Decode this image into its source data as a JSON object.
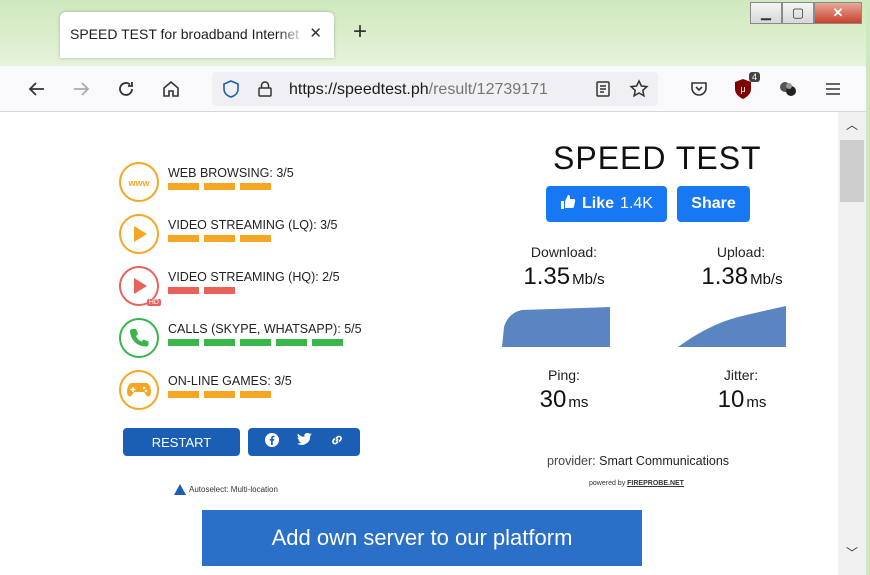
{
  "window": {
    "min": "▁",
    "max": "▢",
    "close": "✕"
  },
  "tab": {
    "title": "SPEED TEST for broadband Internet",
    "close": "✕",
    "new_tab": "+"
  },
  "toolbar": {
    "url_host": "https://speedtest.ph",
    "url_path": "/result/12739171",
    "extension_badge": "4"
  },
  "categories": [
    {
      "label": "WEB BROWSING: 3/5",
      "score": 3,
      "color": "#f5a623",
      "icon": "www-icon"
    },
    {
      "label": "VIDEO STREAMING (LQ): 3/5",
      "score": 3,
      "color": "#f5a623",
      "icon": "play-icon"
    },
    {
      "label": "VIDEO STREAMING (HQ): 2/5",
      "score": 2,
      "color": "#e8625b",
      "icon": "play-hd-icon"
    },
    {
      "label": "CALLS (SKYPE, WHATSAPP): 5/5",
      "score": 5,
      "color": "#39b54a",
      "icon": "phone-icon"
    },
    {
      "label": "ON-LINE GAMES: 3/5",
      "score": 3,
      "color": "#f5a623",
      "icon": "gamepad-icon"
    }
  ],
  "icon_text": {
    "www": "www",
    "hd": "HD"
  },
  "restart_label": "RESTART",
  "autoselect": "Autoselect: Multi-location",
  "title": "SPEED TEST",
  "facebook": {
    "like_label": "Like",
    "like_count": "1.4K",
    "share_label": "Share"
  },
  "metrics": {
    "download": {
      "label": "Download:",
      "value": "1.35",
      "unit": "Mb/s"
    },
    "upload": {
      "label": "Upload:",
      "value": "1.38",
      "unit": "Mb/s"
    },
    "ping": {
      "label": "Ping:",
      "value": "30",
      "unit": "ms"
    },
    "jitter": {
      "label": "Jitter:",
      "value": "10",
      "unit": "ms"
    }
  },
  "provider": {
    "prefix": "provider:",
    "name": "Smart Communications"
  },
  "powered": {
    "prefix": "powered by",
    "name": "FIREPROBE.NET"
  },
  "add_server_label": "Add own server to our platform"
}
